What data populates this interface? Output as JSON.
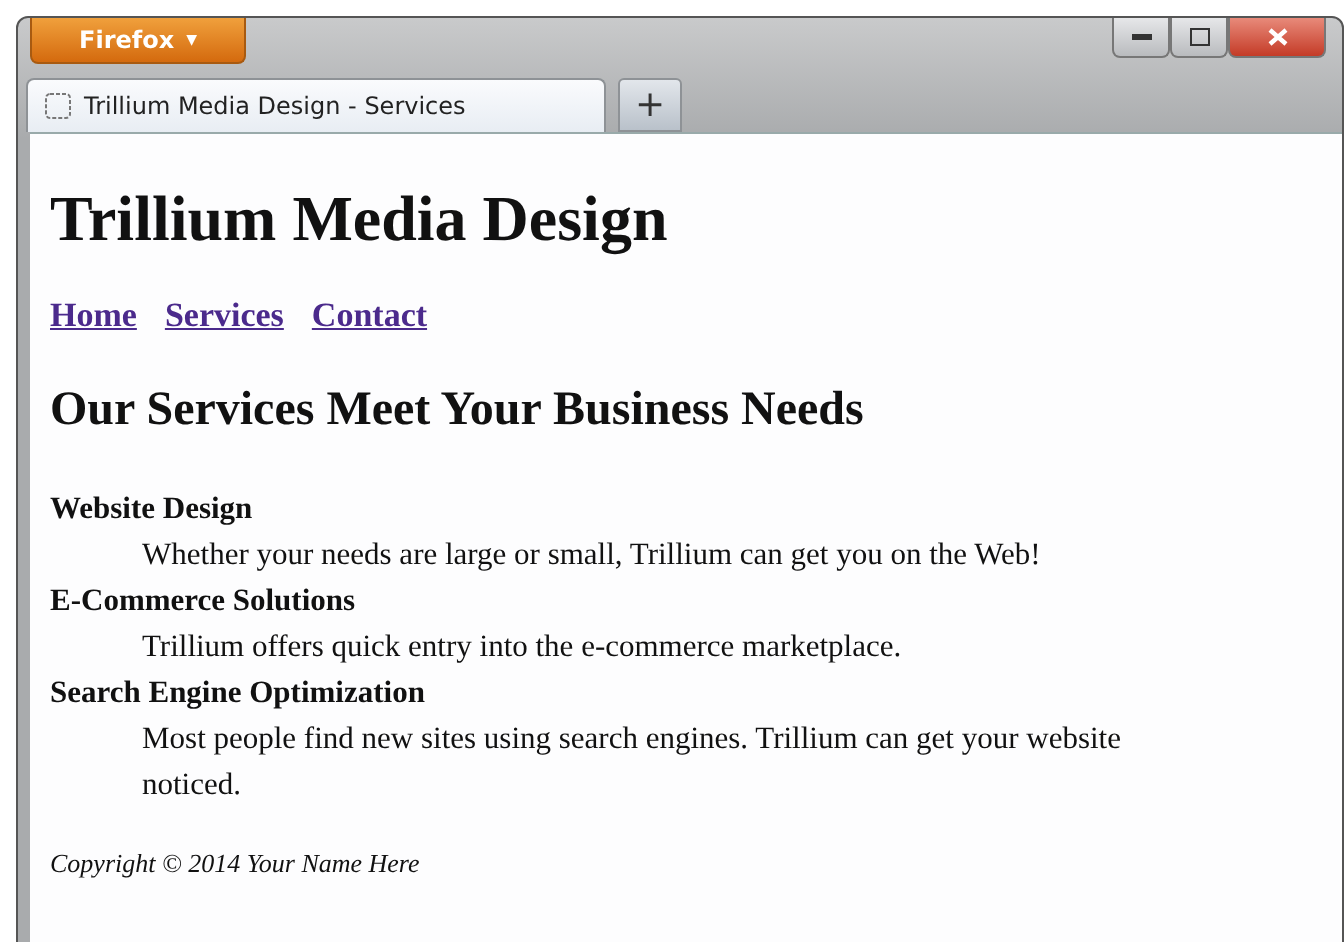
{
  "window": {
    "app_button": "Firefox",
    "app_caret": "▼"
  },
  "tabs": [
    {
      "label": "Trillium Media Design - Services",
      "selected": true
    }
  ],
  "new_tab": "+",
  "page": {
    "title": "Trillium Media Design",
    "nav": [
      "Home",
      "Services",
      "Contact"
    ],
    "heading": "Our Services Meet Your Business Needs",
    "services": [
      {
        "term": "Website Design",
        "description": "Whether your needs are large or small, Trillium can get you on the Web!"
      },
      {
        "term": "E-Commerce Solutions",
        "description": "Trillium offers quick entry into the e-commerce marketplace."
      },
      {
        "term": "Search Engine Optimization",
        "description": "Most people find new sites using search engines. Trillium can get your website noticed."
      }
    ],
    "footer": "Copyright © 2014 Your Name Here"
  }
}
